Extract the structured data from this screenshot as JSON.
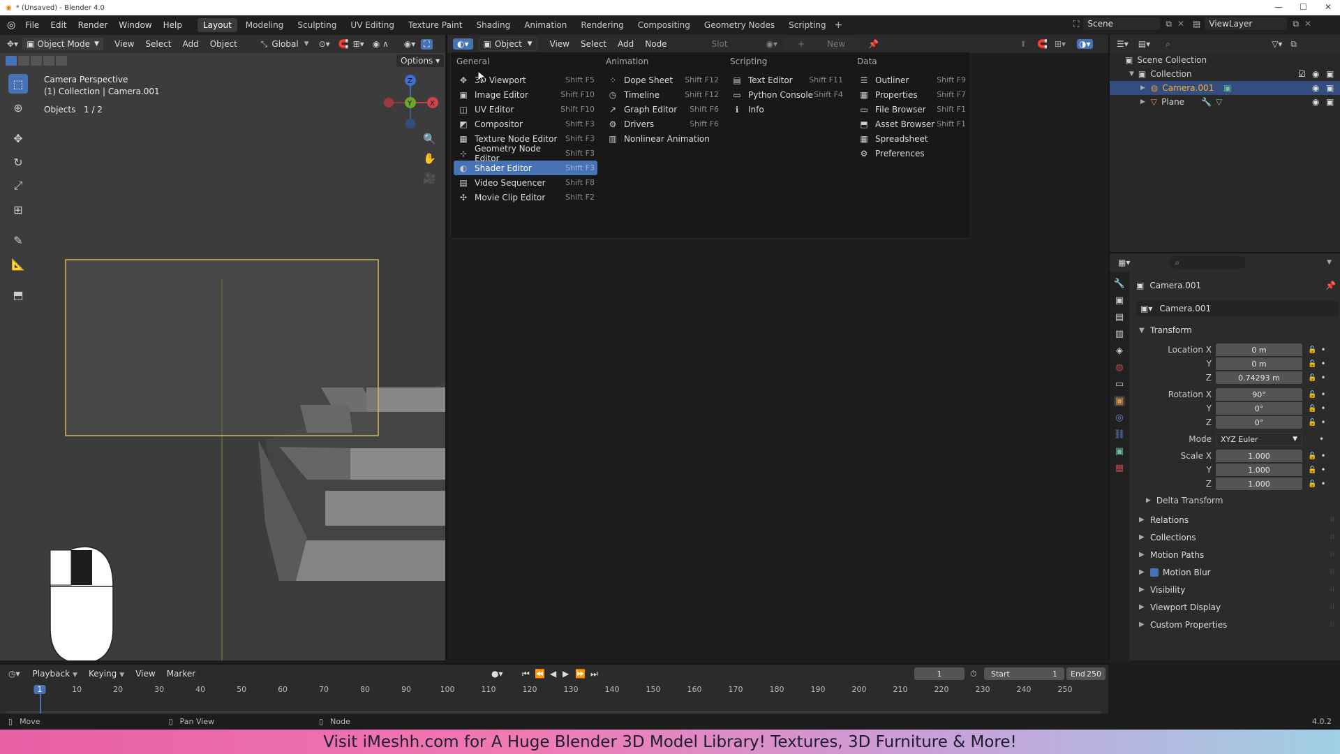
{
  "window": {
    "title": "* (Unsaved) - Blender 4.0"
  },
  "menu": [
    "File",
    "Edit",
    "Render",
    "Window",
    "Help"
  ],
  "workspaces": [
    "Layout",
    "Modeling",
    "Sculpting",
    "UV Editing",
    "Texture Paint",
    "Shading",
    "Animation",
    "Rendering",
    "Compositing",
    "Geometry Nodes",
    "Scripting"
  ],
  "scene": {
    "label": "Scene",
    "view_layer": "ViewLayer"
  },
  "viewport": {
    "mode": "Object Mode",
    "menus": [
      "View",
      "Select",
      "Add",
      "Object"
    ],
    "orientation": "Global",
    "options_label": "Options",
    "overlay_title": "Camera Perspective",
    "overlay_collection": "(1) Collection | Camera.001",
    "objects_label": "Objects",
    "objects_count": "1 / 2",
    "gizmo_axes": [
      "X",
      "Y",
      "Z"
    ]
  },
  "shader_header": {
    "object_label": "Object",
    "menus": [
      "View",
      "Select",
      "Add",
      "Node"
    ],
    "slot_label": "Slot",
    "new_label": "New"
  },
  "editor_popup": {
    "columns": [
      {
        "title": "General",
        "items": [
          {
            "icon": "viewport-icon",
            "glyph": "✥",
            "label": "3D Viewport",
            "shortcut": "Shift F5"
          },
          {
            "icon": "image-icon",
            "glyph": "▣",
            "label": "Image Editor",
            "shortcut": "Shift F10"
          },
          {
            "icon": "uv-icon",
            "glyph": "◫",
            "label": "UV Editor",
            "shortcut": "Shift F10"
          },
          {
            "icon": "compositor-icon",
            "glyph": "◩",
            "label": "Compositor",
            "shortcut": "Shift F3"
          },
          {
            "icon": "texture-node-icon",
            "glyph": "▦",
            "label": "Texture Node Editor",
            "shortcut": "Shift F3"
          },
          {
            "icon": "geometry-node-icon",
            "glyph": "⊹",
            "label": "Geometry Node Editor",
            "shortcut": "Shift F3"
          },
          {
            "icon": "shader-icon",
            "glyph": "◐",
            "label": "Shader Editor",
            "shortcut": "Shift F3",
            "selected": true
          },
          {
            "icon": "video-icon",
            "glyph": "▤",
            "label": "Video Sequencer",
            "shortcut": "Shift F8"
          },
          {
            "icon": "movie-clip-icon",
            "glyph": "✣",
            "label": "Movie Clip Editor",
            "shortcut": "Shift F2"
          }
        ]
      },
      {
        "title": "Animation",
        "items": [
          {
            "icon": "dope-sheet-icon",
            "glyph": "⁘",
            "label": "Dope Sheet",
            "shortcut": "Shift F12"
          },
          {
            "icon": "timeline-icon",
            "glyph": "◷",
            "label": "Timeline",
            "shortcut": "Shift F12"
          },
          {
            "icon": "graph-icon",
            "glyph": "↗",
            "label": "Graph Editor",
            "shortcut": "Shift F6"
          },
          {
            "icon": "drivers-icon",
            "glyph": "⚙",
            "label": "Drivers",
            "shortcut": "Shift F6"
          },
          {
            "icon": "nla-icon",
            "glyph": "▥",
            "label": "Nonlinear Animation",
            "shortcut": ""
          }
        ]
      },
      {
        "title": "Scripting",
        "items": [
          {
            "icon": "text-icon",
            "glyph": "▤",
            "label": "Text Editor",
            "shortcut": "Shift F11"
          },
          {
            "icon": "console-icon",
            "glyph": "▭",
            "label": "Python Console",
            "shortcut": "Shift F4"
          },
          {
            "icon": "info-icon",
            "glyph": "ℹ",
            "label": "Info",
            "shortcut": ""
          }
        ]
      },
      {
        "title": "Data",
        "items": [
          {
            "icon": "outliner-icon",
            "glyph": "☰",
            "label": "Outliner",
            "shortcut": "Shift F9"
          },
          {
            "icon": "properties-icon",
            "glyph": "▦",
            "label": "Properties",
            "shortcut": "Shift F7"
          },
          {
            "icon": "file-browser-icon",
            "glyph": "▭",
            "label": "File Browser",
            "shortcut": "Shift F1"
          },
          {
            "icon": "asset-browser-icon",
            "glyph": "⬒",
            "label": "Asset Browser",
            "shortcut": "Shift F1"
          },
          {
            "icon": "spreadsheet-icon",
            "glyph": "▦",
            "label": "Spreadsheet",
            "shortcut": ""
          },
          {
            "icon": "preferences-icon",
            "glyph": "⚙",
            "label": "Preferences",
            "shortcut": ""
          }
        ]
      }
    ]
  },
  "outliner": {
    "root": "Scene Collection",
    "collection": "Collection",
    "objects": [
      {
        "name": "Camera.001",
        "selected": true
      },
      {
        "name": "Plane",
        "selected": false
      }
    ]
  },
  "properties": {
    "object_name": "Camera.001",
    "data_name": "Camera.001",
    "section": "Transform",
    "location": {
      "label": "Location X",
      "x": "0 m",
      "y": "0 m",
      "z": "0.74293 m"
    },
    "rotation": {
      "label": "Rotation X",
      "x": "90°",
      "y": "0°",
      "z": "0°"
    },
    "mode": {
      "label": "Mode",
      "value": "XYZ Euler"
    },
    "scale": {
      "label": "Scale X",
      "x": "1.000",
      "y": "1.000",
      "z": "1.000"
    },
    "axis_y": "Y",
    "axis_z": "Z",
    "subpanel": "Delta Transform",
    "panels": [
      "Relations",
      "Collections",
      "Motion Paths",
      "Motion Blur",
      "Visibility",
      "Viewport Display",
      "Custom Properties"
    ]
  },
  "timeline": {
    "menus": [
      "Playback",
      "Keying",
      "View",
      "Marker"
    ],
    "current_frame": "1",
    "start_label": "Start",
    "start": "1",
    "end_label": "End",
    "end": "250",
    "ticks": [
      "1",
      "10",
      "20",
      "30",
      "40",
      "50",
      "60",
      "70",
      "80",
      "90",
      "100",
      "110",
      "120",
      "130",
      "140",
      "150",
      "160",
      "170",
      "180",
      "190",
      "200",
      "210",
      "220",
      "230",
      "240",
      "250"
    ]
  },
  "statusbar": {
    "move": "Move",
    "pan": "Pan View",
    "node": "Node",
    "version": "4.0.2"
  },
  "banner": {
    "text": "Visit iMeshh.com for A Huge Blender 3D Model Library! Textures, 3D Furniture & More!"
  }
}
